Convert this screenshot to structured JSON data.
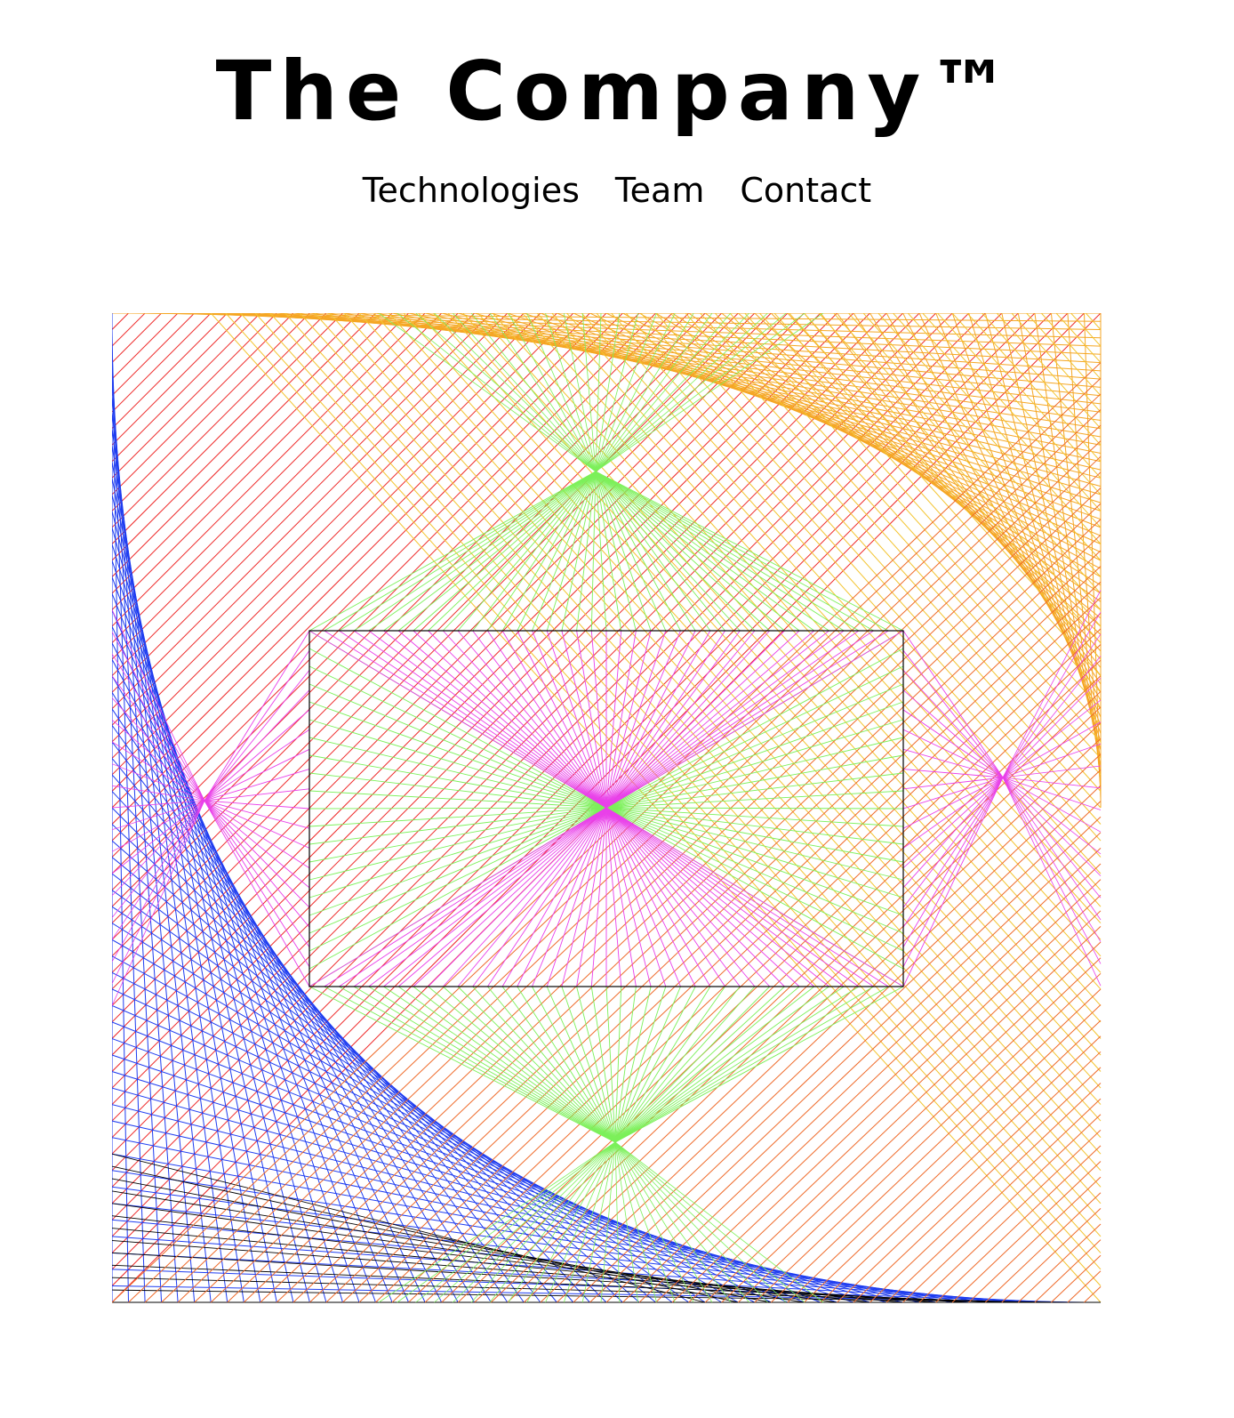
{
  "header": {
    "title": "The Company™"
  },
  "nav": {
    "items": [
      {
        "label": "Technologies"
      },
      {
        "label": "Team"
      },
      {
        "label": "Contact"
      }
    ]
  },
  "artwork": {
    "style": "string-art line envelopes",
    "colors": {
      "red": "#ee2a2a",
      "orange_top": "#f5a623",
      "yellow": "#f3c430",
      "orange_bottom": "#ef6a2a",
      "blue": "#1e3cf0",
      "magenta": "#e940e9",
      "green": "#7cf05a",
      "black": "#000000"
    }
  }
}
